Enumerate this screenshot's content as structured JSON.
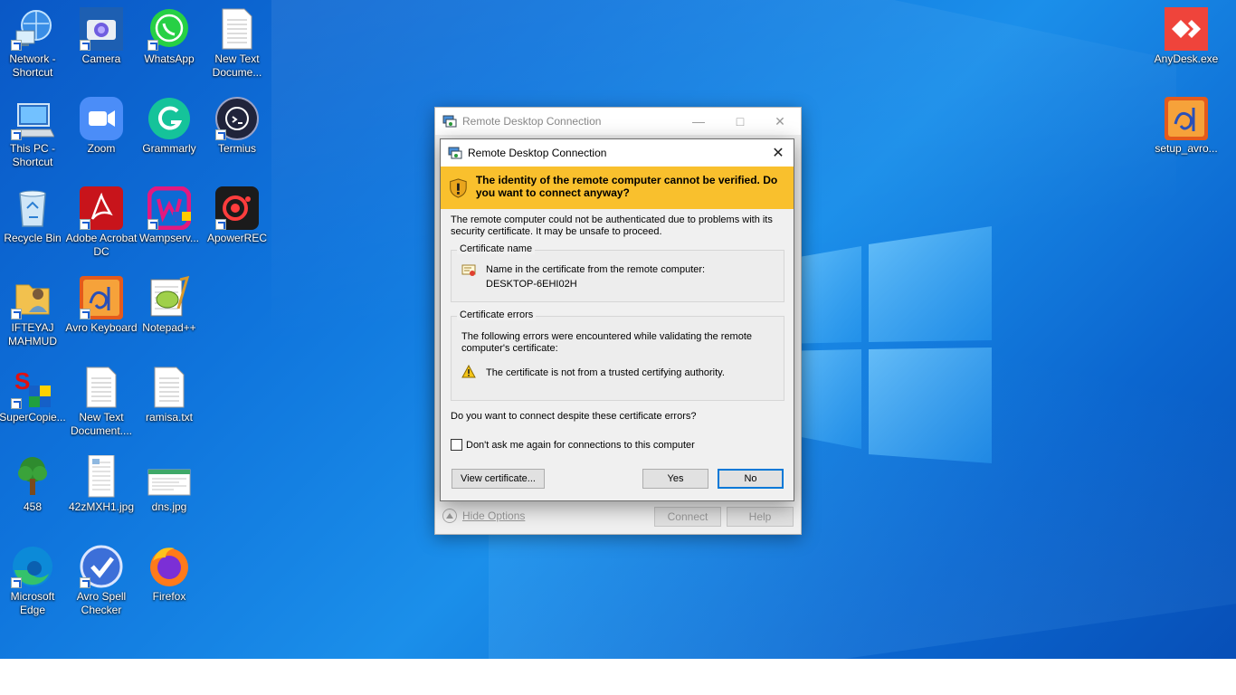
{
  "desktop_icons": [
    {
      "label": "Network - Shortcut",
      "icon": "network-icon"
    },
    {
      "label": "Camera",
      "icon": "camera-icon"
    },
    {
      "label": "WhatsApp",
      "icon": "whatsapp-icon"
    },
    {
      "label": "New Text Docume...",
      "icon": "text-file-icon"
    },
    {
      "label": "This PC - Shortcut",
      "icon": "computer-icon"
    },
    {
      "label": "Zoom",
      "icon": "zoom-icon"
    },
    {
      "label": "Grammarly",
      "icon": "grammarly-icon"
    },
    {
      "label": "Termius",
      "icon": "termius-icon"
    },
    {
      "label": "Recycle Bin",
      "icon": "recycle-bin-icon"
    },
    {
      "label": "Adobe Acrobat DC",
      "icon": "acrobat-icon"
    },
    {
      "label": "Wampserv...",
      "icon": "wampserver-icon"
    },
    {
      "label": "ApowerREC",
      "icon": "apowerrec-icon"
    },
    {
      "label": "IFTEYAJ MAHMUD",
      "icon": "user-folder-icon"
    },
    {
      "label": "Avro Keyboard",
      "icon": "avro-icon"
    },
    {
      "label": "Notepad++",
      "icon": "notepadpp-icon"
    },
    {
      "label": "SuperCopie...",
      "icon": "supercopier-icon"
    },
    {
      "label": "New Text Document....",
      "icon": "text-file-icon"
    },
    {
      "label": "ramisa.txt",
      "icon": "text-file-icon"
    },
    {
      "label": "458",
      "icon": "tree-icon"
    },
    {
      "label": "42zMXH1.jpg",
      "icon": "image-file-icon"
    },
    {
      "label": "dns.jpg",
      "icon": "image-file-icon"
    },
    {
      "label": "Microsoft Edge",
      "icon": "edge-icon"
    },
    {
      "label": "Avro Spell Checker",
      "icon": "spellcheck-icon"
    },
    {
      "label": "Firefox",
      "icon": "firefox-icon"
    },
    {
      "label": "AnyDesk.exe",
      "icon": "anydesk-icon"
    },
    {
      "label": "setup_avro...",
      "icon": "avro-icon"
    }
  ],
  "outer_window": {
    "title": "Remote Desktop Connection",
    "hide_options": "Hide Options",
    "connect": "Connect",
    "help": "Help"
  },
  "dialog": {
    "title": "Remote Desktop Connection",
    "warning": "The identity of the remote computer cannot be verified. Do you want to connect anyway?",
    "description": "The remote computer could not be authenticated due to problems with its security certificate. It may be unsafe to proceed.",
    "cert_name_title": "Certificate name",
    "cert_name_label": "Name in the certificate from the remote computer:",
    "cert_name_value": "DESKTOP-6EHI02H",
    "cert_errors_title": "Certificate errors",
    "cert_errors_intro": "The following errors were encountered while validating the remote computer's certificate:",
    "cert_error_1": "The certificate is not from a trusted certifying authority.",
    "confirm_question": "Do you want to connect despite these certificate errors?",
    "dont_ask_label": "Don't ask me again for connections to this computer",
    "dont_ask_checked": false,
    "view_certificate": "View certificate...",
    "yes": "Yes",
    "no": "No"
  },
  "colors": {
    "banner": "#f9c02d",
    "default_button_border": "#0078d7",
    "desktop_blue": "#0f74dc"
  }
}
